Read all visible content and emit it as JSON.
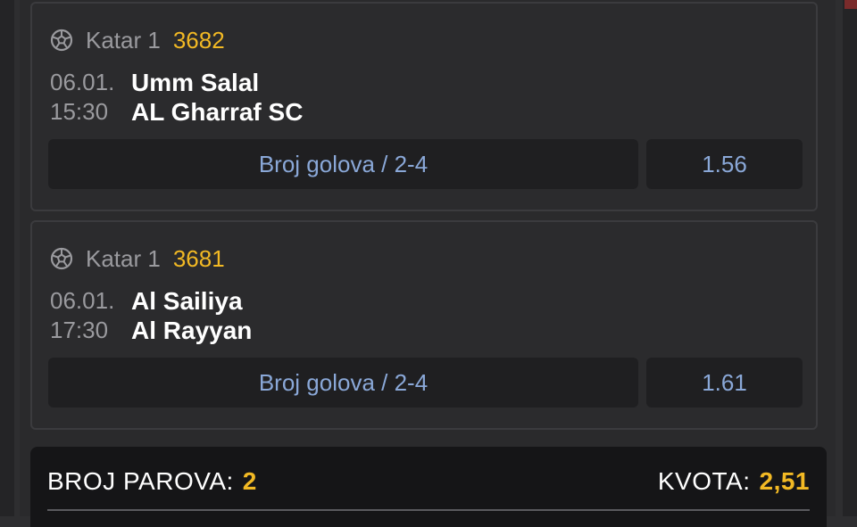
{
  "matches": [
    {
      "league": "Katar 1",
      "code": "3682",
      "date": "06.01.",
      "time": "15:30",
      "home": "Umm Salal",
      "away": "AL Gharraf SC",
      "market": "Broj golova / 2-4",
      "odd": "1.56"
    },
    {
      "league": "Katar 1",
      "code": "3681",
      "date": "06.01.",
      "time": "17:30",
      "home": "Al Sailiya",
      "away": "Al Rayyan",
      "market": "Broj golova / 2-4",
      "odd": "1.61"
    }
  ],
  "summary": {
    "pairs_label": "BROJ PAROVA:",
    "pairs_value": "2",
    "odds_label": "KVOTA:",
    "odds_value": "2,51"
  },
  "colors": {
    "accent": "#f2b924",
    "market_text": "#8aa8d8",
    "card_bg": "#2b2b2d"
  },
  "icons": {
    "sport": "soccer-ball-icon"
  }
}
